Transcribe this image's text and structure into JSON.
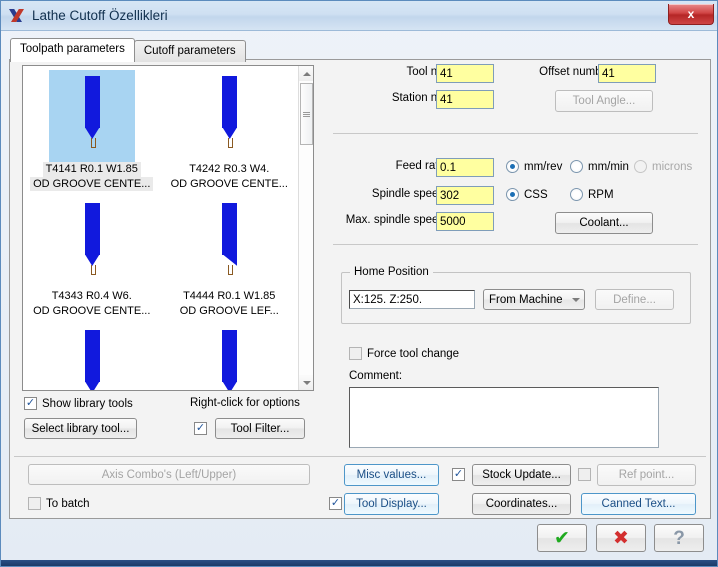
{
  "window": {
    "title": "Lathe Cutoff Özellikleri",
    "icon": "mastercam-icon",
    "close_label": "x"
  },
  "tabs": [
    {
      "label": "Toolpath parameters",
      "active": true
    },
    {
      "label": "Cutoff parameters",
      "active": false
    }
  ],
  "tool_list": {
    "tools": [
      {
        "line1": "T4141 R0.1 W1.85",
        "line2": "OD GROOVE CENTE...",
        "selected": true,
        "tip": "center"
      },
      {
        "line1": "T4242 R0.3 W4.",
        "line2": "OD GROOVE CENTE...",
        "selected": false,
        "tip": "center"
      },
      {
        "line1": "T4343 R0.4 W6.",
        "line2": "OD GROOVE CENTE...",
        "selected": false,
        "tip": "center"
      },
      {
        "line1": "T4444 R0.1 W1.85",
        "line2": "OD GROOVE LEF...",
        "selected": false,
        "tip": "left"
      }
    ],
    "scroll_position": "near-top"
  },
  "left_controls": {
    "show_library_tools_label": "Show library tools",
    "show_library_tools_checked": true,
    "right_click_hint": "Right-click for options",
    "select_library_tool_label": "Select library tool...",
    "tool_filter_label": "Tool Filter...",
    "tool_filter_checked": true
  },
  "tool_info": {
    "tool_number_label": "Tool number:",
    "tool_number_value": "41",
    "offset_number_label": "Offset number:",
    "offset_number_value": "41",
    "station_number_label": "Station number:",
    "station_number_value": "41",
    "tool_angle_label": "Tool Angle...",
    "tool_angle_enabled": false
  },
  "speeds": {
    "feed_rate_label": "Feed rate:",
    "feed_rate_value": "0.1",
    "feed_units": [
      {
        "label": "mm/rev",
        "selected": true,
        "enabled": true
      },
      {
        "label": "mm/min",
        "selected": false,
        "enabled": true
      },
      {
        "label": "microns",
        "selected": false,
        "enabled": false
      }
    ],
    "spindle_speed_label": "Spindle speed:",
    "spindle_speed_value": "302",
    "spindle_modes": [
      {
        "label": "CSS",
        "selected": true
      },
      {
        "label": "RPM",
        "selected": false
      }
    ],
    "max_spindle_speed_label": "Max. spindle speed:",
    "max_spindle_speed_value": "5000",
    "coolant_label": "Coolant..."
  },
  "home_position": {
    "group_title": "Home Position",
    "value": "X:125.  Z:250.",
    "source": "From Machine",
    "define_label": "Define...",
    "define_enabled": false
  },
  "force_tool_change": {
    "label": "Force tool change",
    "checked": false
  },
  "comment": {
    "label": "Comment:",
    "value": "",
    "placeholder": ""
  },
  "bottom_controls": {
    "axis_combo_label": "Axis Combo's (Left/Upper)",
    "axis_combo_enabled": false,
    "to_batch_label": "To batch",
    "to_batch_checked": false,
    "misc_values_label": "Misc values...",
    "tool_display_label": "Tool Display...",
    "tool_display_checked": true,
    "stock_update_label": "Stock Update...",
    "stock_update_checked": true,
    "coordinates_label": "Coordinates...",
    "ref_point_label": "Ref point...",
    "ref_point_checked": false,
    "ref_point_enabled": false,
    "canned_text_label": "Canned Text..."
  },
  "dialog_buttons": {
    "ok": "check-icon",
    "cancel": "cross-icon",
    "help": "question-icon"
  },
  "colors": {
    "field_yellow": "#ffffa0",
    "tool_blue": "#1119dd",
    "selection_blue": "#a8d4f2",
    "accent_blue": "#1b4f86",
    "close_red": "#c0392b"
  }
}
